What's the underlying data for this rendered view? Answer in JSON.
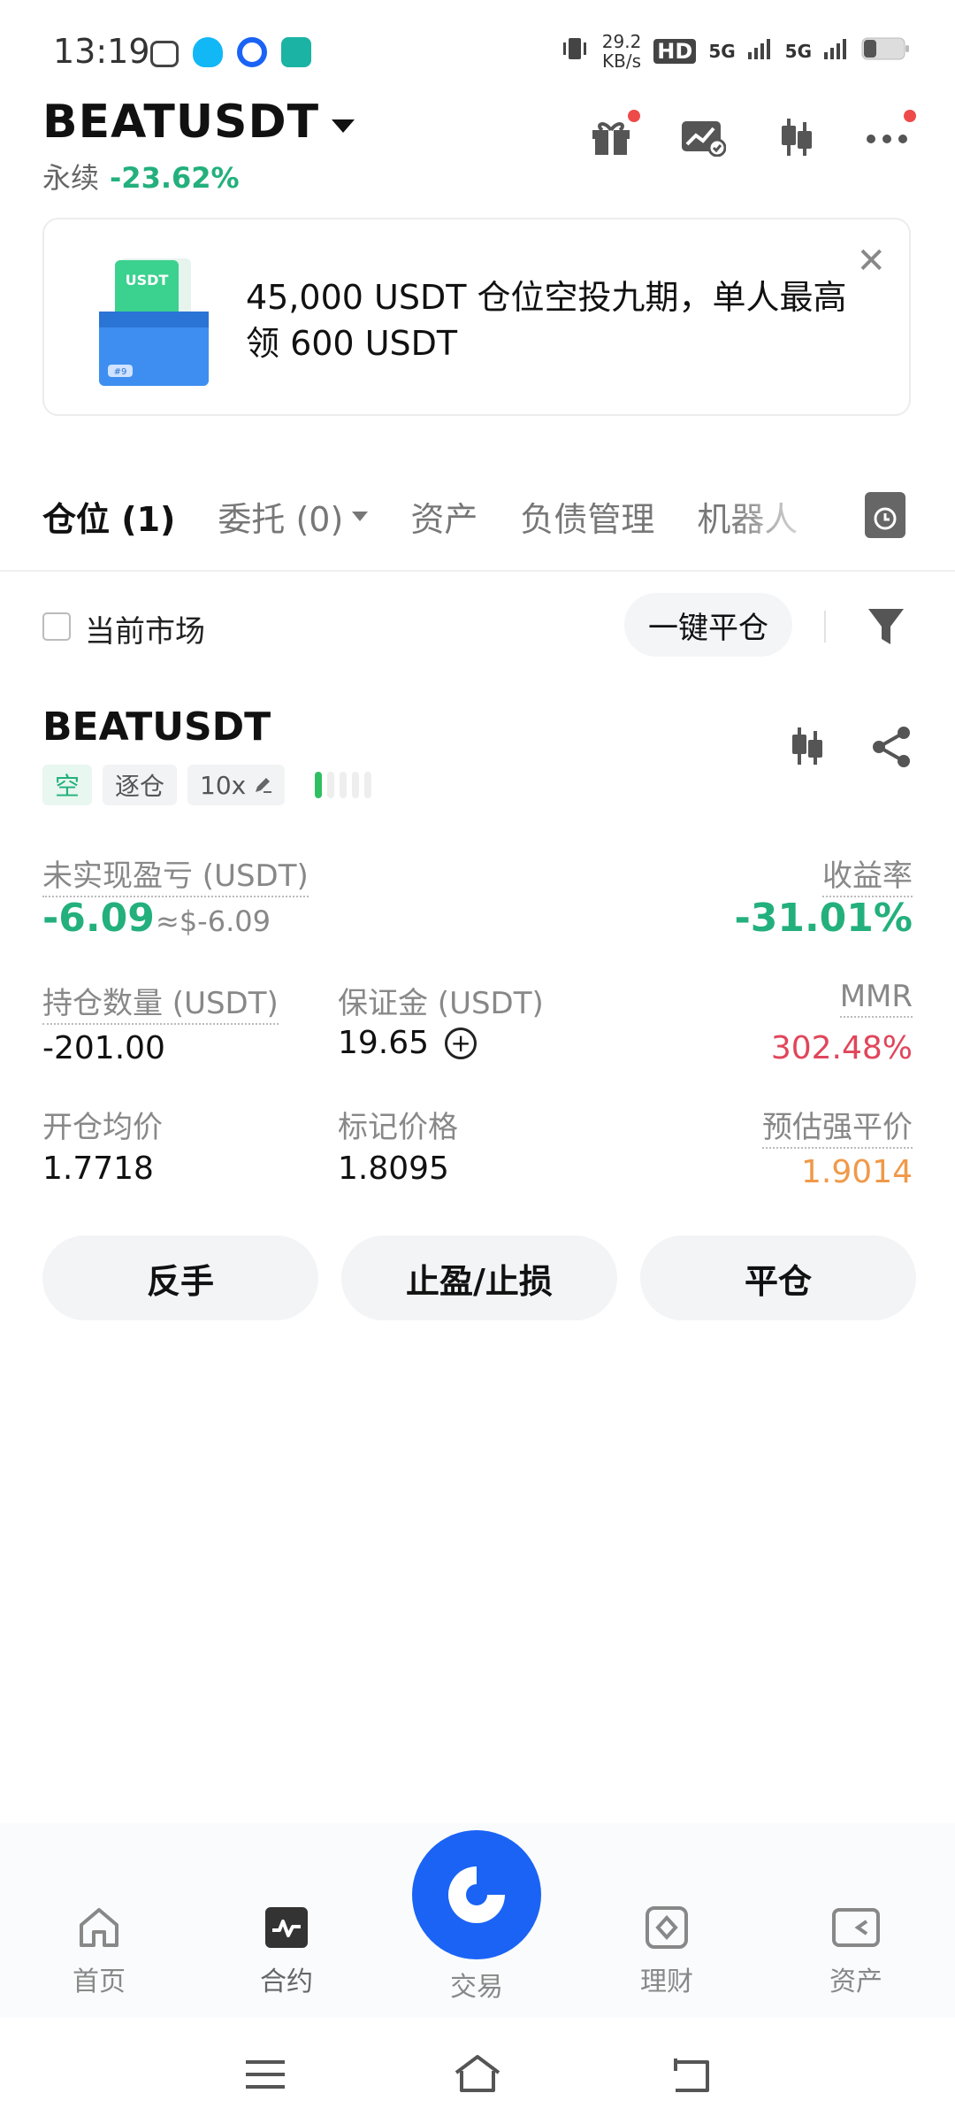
{
  "status_bar": {
    "time": "13:19",
    "net_speed_value": "29.2",
    "net_speed_unit": "KB/s",
    "hd": "HD",
    "signal1": "5G",
    "signal2": "5G"
  },
  "header": {
    "pair": "BEATUSDT",
    "contract_type": "永续",
    "change_pct": "-23.62%"
  },
  "banner": {
    "text": "45,000 USDT 仓位空投九期，单人最高领 600 USDT",
    "art_label": "USDT",
    "art_badge": "#9"
  },
  "tabs": [
    {
      "label": "仓位 (1)"
    },
    {
      "label": "委托 (0)"
    },
    {
      "label": "资产"
    },
    {
      "label": "负债管理"
    },
    {
      "label": "机器人"
    }
  ],
  "filter": {
    "current_market": "当前市场",
    "close_all": "一键平仓"
  },
  "position": {
    "symbol": "BEATUSDT",
    "side": "空",
    "margin_mode": "逐仓",
    "leverage": "10x",
    "risk_level": 0.2,
    "upnl_label": "未实现盈亏 (USDT)",
    "upnl_value": "-6.09",
    "upnl_approx": "≈$-6.09",
    "roi_label": "收益率",
    "roi_value": "-31.01%",
    "qty_label": "持仓数量 (USDT)",
    "qty_value": "-201.00",
    "margin_label": "保证金 (USDT)",
    "margin_value": "19.65",
    "mmr_label": "MMR",
    "mmr_value": "302.48%",
    "entry_label": "开仓均价",
    "entry_value": "1.7718",
    "mark_label": "标记价格",
    "mark_value": "1.8095",
    "liq_label": "预估强平价",
    "liq_value": "1.9014",
    "btn_reverse": "反手",
    "btn_tpsl": "止盈/止损",
    "btn_close": "平仓"
  },
  "bottom_nav": {
    "home": "首页",
    "futures": "合约",
    "trade": "交易",
    "earn": "理财",
    "assets": "资产"
  },
  "colors": {
    "green": "#23b07c",
    "red": "#e0465b",
    "orange": "#f0994a",
    "brand_blue": "#1a63f5"
  }
}
